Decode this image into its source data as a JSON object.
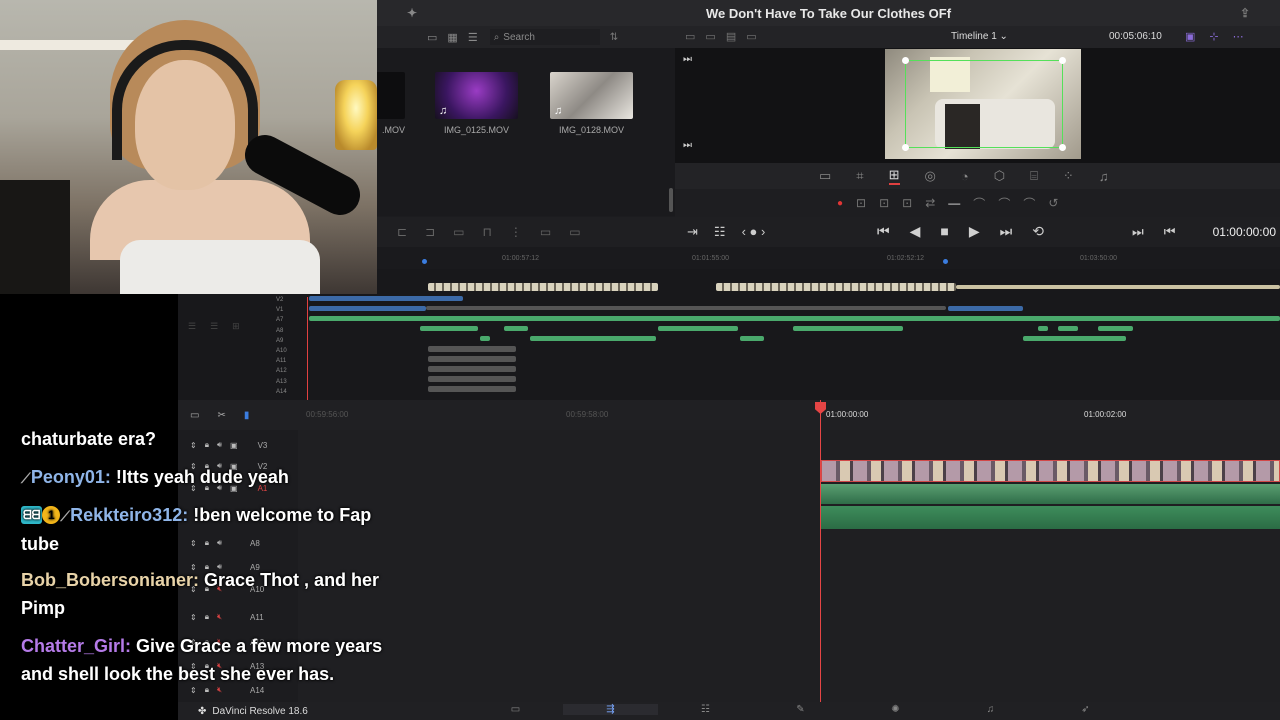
{
  "window": {
    "title": "We Don't Have To Take Our Clothes OFf"
  },
  "media_pool": {
    "search_placeholder": "Search",
    "clips": [
      {
        "name": ".MOV"
      },
      {
        "name": "IMG_0125.MOV"
      },
      {
        "name": "IMG_0128.MOV"
      }
    ]
  },
  "viewer": {
    "timeline_name": "Timeline 1",
    "duration": "00:05:06:10",
    "timecode": "01:00:00:00"
  },
  "mini_ruler": [
    "01:00:57:12",
    "01:01:55:00",
    "01:02:52:12",
    "01:03:50:00"
  ],
  "mini_tracks": [
    "V2",
    "V1",
    "A7",
    "A8",
    "A9",
    "A10",
    "A11",
    "A12",
    "A13",
    "A14"
  ],
  "main_ruler": [
    "00:59:56:00",
    "00:59:58:00",
    "01:00:00:00",
    "01:00:02:00"
  ],
  "tracks": [
    {
      "label": "V3"
    },
    {
      "label": "V2"
    },
    {
      "label": "A1"
    },
    {
      "label": "A8"
    },
    {
      "label": "A9"
    },
    {
      "label": "A10"
    },
    {
      "label": "A11"
    },
    {
      "label": "A12"
    },
    {
      "label": "A13"
    },
    {
      "label": "A14"
    }
  ],
  "app": {
    "name": "DaVinci Resolve 18.6"
  },
  "chat": [
    {
      "user": "",
      "color": "#ffffff",
      "text": "chaturbate era?"
    },
    {
      "user": "Peony01:",
      "color": "#8fb5e8",
      "text": " !Itts yeah dude yeah"
    },
    {
      "user": "Rekkteiro312:",
      "color": "#8fb5e8",
      "text": " !ben welcome to Fap tube"
    },
    {
      "user": "Bob_Bobersonianer:",
      "color": "#e8d3a8",
      "text": " Grace Thot , and her Pimp"
    },
    {
      "user": "Chatter_Girl:",
      "color": "#b57be8",
      "text": " Give Grace a few more years and shell look the best she ever has."
    }
  ],
  "colors": {
    "accent": "#e54545",
    "selection": "#55e05a",
    "page_active": "#7aa8ff"
  }
}
